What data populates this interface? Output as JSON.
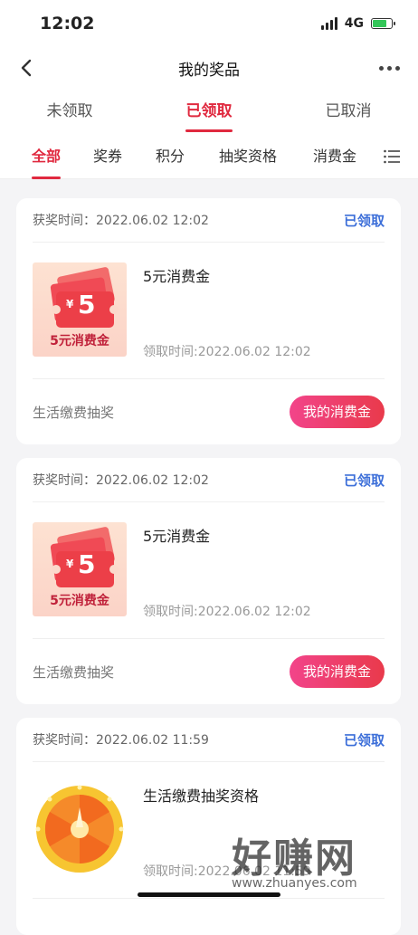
{
  "status_bar": {
    "time": "12:02",
    "network": "4G"
  },
  "nav": {
    "title": "我的奖品"
  },
  "status_tabs": [
    {
      "label": "未领取"
    },
    {
      "label": "已领取"
    },
    {
      "label": "已取消"
    }
  ],
  "category_tabs": [
    {
      "label": "全部"
    },
    {
      "label": "奖券"
    },
    {
      "label": "积分"
    },
    {
      "label": "抽奖资格"
    },
    {
      "label": "消费金"
    }
  ],
  "cards": [
    {
      "award_time": "获奖时间：2022.06.02 12:02",
      "status": "已领取",
      "prize_name": "5元消费金",
      "claim_time": "领取时间:2022.06.02 12:02",
      "thumb_symbol": "¥",
      "thumb_value": "5",
      "thumb_caption": "5元消费金",
      "source": "生活缴费抽奖",
      "action": "我的消费金"
    },
    {
      "award_time": "获奖时间：2022.06.02 12:02",
      "status": "已领取",
      "prize_name": "5元消费金",
      "claim_time": "领取时间:2022.06.02 12:02",
      "thumb_symbol": "¥",
      "thumb_value": "5",
      "thumb_caption": "5元消费金",
      "source": "生活缴费抽奖",
      "action": "我的消费金"
    },
    {
      "award_time": "获奖时间：2022.06.02 11:59",
      "status": "已领取",
      "prize_name": "生活缴费抽奖资格",
      "claim_time": "领取时间:2022.06.02 11:59"
    }
  ],
  "watermark": {
    "text": "好赚网",
    "url": "www.zhuanyes.com"
  },
  "colors": {
    "accent": "#e0293f",
    "status_blue": "#3d6fd9",
    "button_gradient_start": "#f2448a",
    "button_gradient_end": "#e93a4b"
  }
}
